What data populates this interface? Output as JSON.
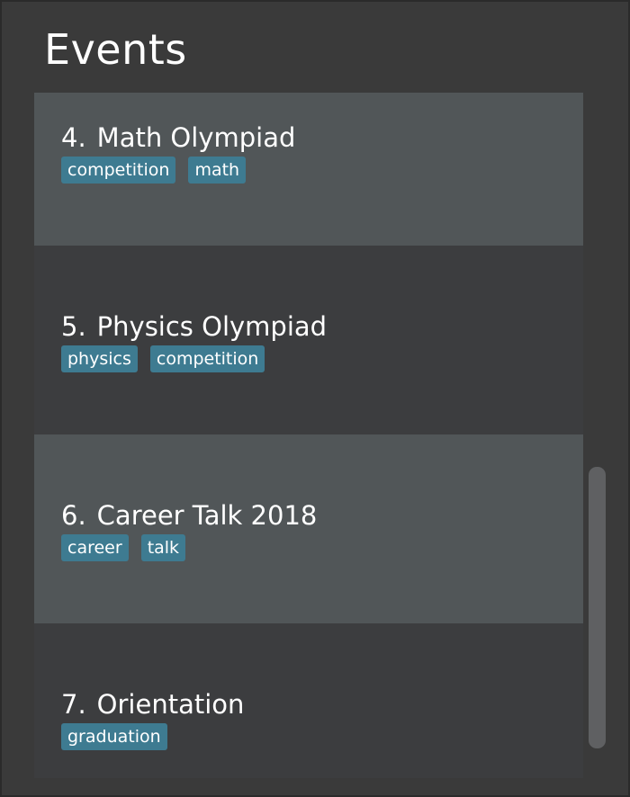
{
  "panel": {
    "title": "Events"
  },
  "events": [
    {
      "index": "4.",
      "name": "Math Olympiad",
      "tags": [
        "competition",
        "math"
      ]
    },
    {
      "index": "5.",
      "name": "Physics Olympiad",
      "tags": [
        "physics",
        "competition"
      ]
    },
    {
      "index": "6.",
      "name": "Career Talk 2018",
      "tags": [
        "career",
        "talk"
      ]
    },
    {
      "index": "7.",
      "name": "Orientation",
      "tags": [
        "graduation"
      ]
    }
  ],
  "colors": {
    "background": "#3a3a3a",
    "card_alt": "#515658",
    "card_plain": "#3c3d3f",
    "tag": "#3e7b91",
    "scrollbar_thumb": "#5f6062"
  }
}
